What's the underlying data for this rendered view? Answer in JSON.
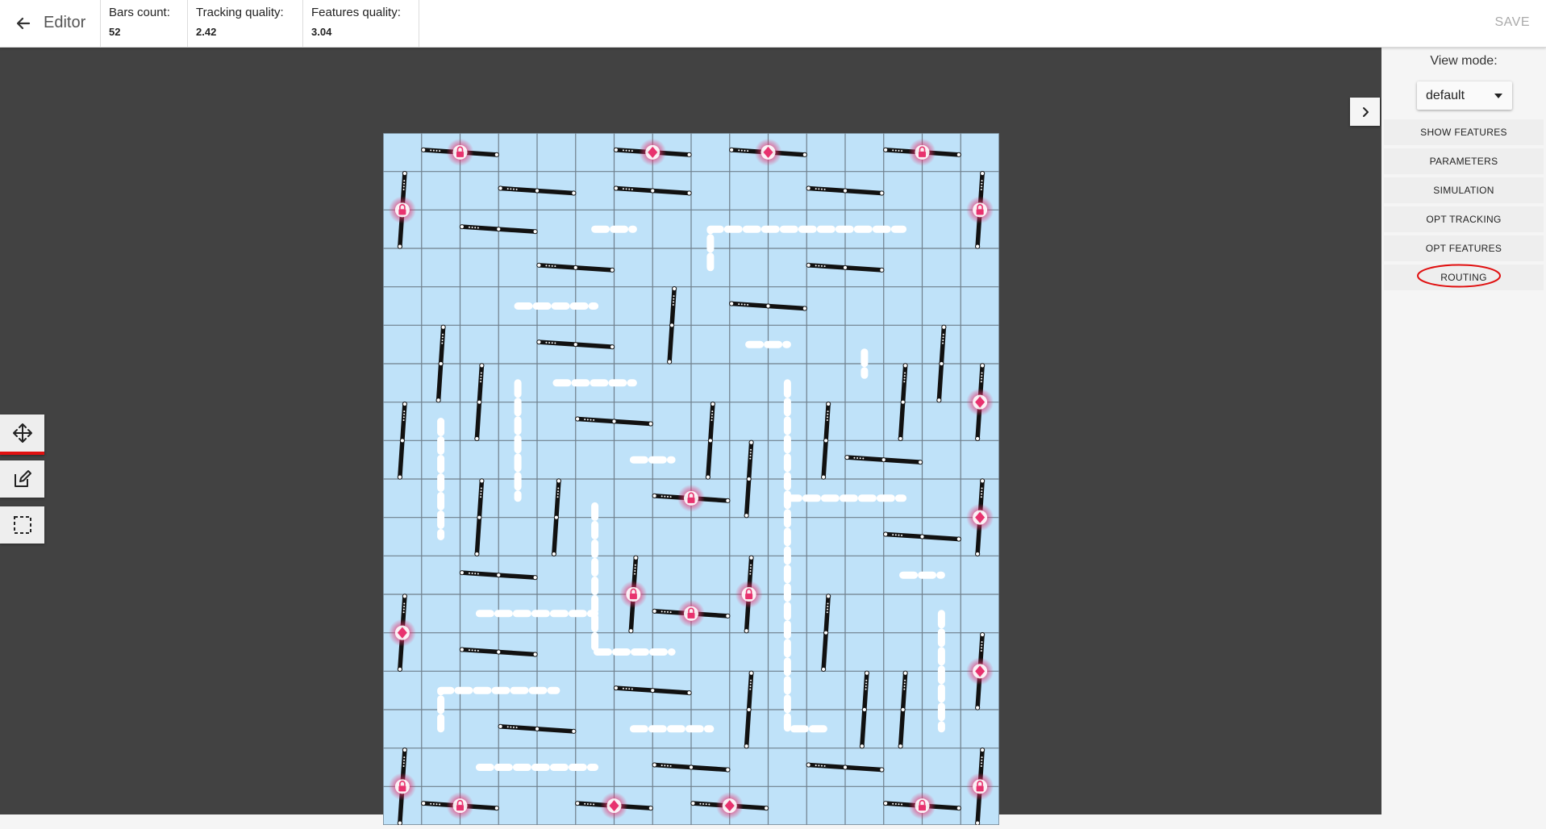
{
  "header": {
    "title": "Editor",
    "stats": [
      {
        "label": "Bars count:",
        "value": "52"
      },
      {
        "label": "Tracking quality:",
        "value": "2.42"
      },
      {
        "label": "Features quality:",
        "value": "3.04"
      }
    ],
    "save_label": "SAVE"
  },
  "panel": {
    "view_mode_label": "View mode:",
    "view_mode_value": "default",
    "buttons": [
      {
        "label": "SHOW FEATURES"
      },
      {
        "label": "PARAMETERS"
      },
      {
        "label": "SIMULATION"
      },
      {
        "label": "OPT TRACKING"
      },
      {
        "label": "OPT FEATURES"
      },
      {
        "label": "ROUTING"
      }
    ]
  },
  "tools": [
    {
      "icon": "move-icon",
      "active": true
    },
    {
      "icon": "edit-icon",
      "active": false
    },
    {
      "icon": "select-rect-icon",
      "active": false
    }
  ],
  "colors": {
    "board_fill": "#bfe2f9",
    "grid_line": "#6f7f8c",
    "bar": "#111111",
    "route": "#ffffff",
    "lock": "#e8326e",
    "highlight": "#e01010",
    "workspace": "#424242"
  },
  "board": {
    "cols": 16,
    "rows": 18,
    "bars": [
      {
        "type": "h",
        "col": 1,
        "row": 0,
        "pinned": true,
        "lock": "lock"
      },
      {
        "type": "h",
        "col": 6,
        "row": 0,
        "pinned": true,
        "lock": "diamond"
      },
      {
        "type": "h",
        "col": 9,
        "row": 0,
        "pinned": true,
        "lock": "diamond"
      },
      {
        "type": "h",
        "col": 13,
        "row": 0,
        "pinned": true,
        "lock": "lock"
      },
      {
        "type": "h",
        "col": 3,
        "row": 1
      },
      {
        "type": "h",
        "col": 6,
        "row": 1
      },
      {
        "type": "h",
        "col": 11,
        "row": 1
      },
      {
        "type": "h",
        "col": 2,
        "row": 2
      },
      {
        "type": "h",
        "col": 4,
        "row": 3
      },
      {
        "type": "h",
        "col": 11,
        "row": 3
      },
      {
        "type": "h",
        "col": 9,
        "row": 4
      },
      {
        "type": "h",
        "col": 4,
        "row": 5
      },
      {
        "type": "h",
        "col": 5,
        "row": 7
      },
      {
        "type": "h",
        "col": 12,
        "row": 8
      },
      {
        "type": "h",
        "col": 7,
        "row": 9,
        "pinned": true,
        "lock": "lock"
      },
      {
        "type": "h",
        "col": 13,
        "row": 10
      },
      {
        "type": "h",
        "col": 2,
        "row": 11
      },
      {
        "type": "h",
        "col": 7,
        "row": 12,
        "pinned": true,
        "lock": "lock"
      },
      {
        "type": "h",
        "col": 2,
        "row": 13
      },
      {
        "type": "h",
        "col": 6,
        "row": 14
      },
      {
        "type": "h",
        "col": 3,
        "row": 15
      },
      {
        "type": "h",
        "col": 7,
        "row": 16
      },
      {
        "type": "h",
        "col": 11,
        "row": 16
      },
      {
        "type": "h",
        "col": 1,
        "row": 17,
        "pinned": true,
        "lock": "lock"
      },
      {
        "type": "h",
        "col": 5,
        "row": 17,
        "pinned": true,
        "lock": "diamond"
      },
      {
        "type": "h",
        "col": 8,
        "row": 17,
        "pinned": true,
        "lock": "diamond"
      },
      {
        "type": "h",
        "col": 13,
        "row": 17,
        "pinned": true,
        "lock": "lock"
      },
      {
        "type": "v",
        "col": 0,
        "row": 1,
        "pinned": true,
        "lock": "lock"
      },
      {
        "type": "v",
        "col": 15,
        "row": 1,
        "pinned": true,
        "lock": "lock"
      },
      {
        "type": "v",
        "col": 7,
        "row": 4
      },
      {
        "type": "v",
        "col": 1,
        "row": 5
      },
      {
        "type": "v",
        "col": 14,
        "row": 5
      },
      {
        "type": "v",
        "col": 2,
        "row": 6
      },
      {
        "type": "v",
        "col": 13,
        "row": 6
      },
      {
        "type": "v",
        "col": 15,
        "row": 6,
        "pinned": true,
        "lock": "diamond"
      },
      {
        "type": "v",
        "col": 0,
        "row": 7
      },
      {
        "type": "v",
        "col": 8,
        "row": 7
      },
      {
        "type": "v",
        "col": 11,
        "row": 7
      },
      {
        "type": "v",
        "col": 9,
        "row": 8
      },
      {
        "type": "v",
        "col": 2,
        "row": 9
      },
      {
        "type": "v",
        "col": 4,
        "row": 9
      },
      {
        "type": "v",
        "col": 15,
        "row": 9,
        "pinned": true,
        "lock": "diamond"
      },
      {
        "type": "v",
        "col": 6,
        "row": 11,
        "pinned": true,
        "lock": "lock"
      },
      {
        "type": "v",
        "col": 9,
        "row": 11,
        "pinned": true,
        "lock": "lock"
      },
      {
        "type": "v",
        "col": 0,
        "row": 12,
        "pinned": true,
        "lock": "diamond"
      },
      {
        "type": "v",
        "col": 11,
        "row": 12
      },
      {
        "type": "v",
        "col": 15,
        "row": 13,
        "pinned": true,
        "lock": "diamond"
      },
      {
        "type": "v",
        "col": 9,
        "row": 14
      },
      {
        "type": "v",
        "col": 12,
        "row": 14
      },
      {
        "type": "v",
        "col": 13,
        "row": 14
      },
      {
        "type": "v",
        "col": 0,
        "row": 16,
        "pinned": true,
        "lock": "lock"
      },
      {
        "type": "v",
        "col": 15,
        "row": 16,
        "pinned": true,
        "lock": "lock"
      }
    ],
    "routes": [
      [
        [
          5.5,
          2.5
        ],
        [
          6.5,
          2.5
        ]
      ],
      [
        [
          8.5,
          3.5
        ],
        [
          8.5,
          2.5
        ],
        [
          13.5,
          2.5
        ]
      ],
      [
        [
          3.5,
          4.5
        ],
        [
          5.5,
          4.5
        ]
      ],
      [
        [
          9.5,
          5.5
        ],
        [
          10.5,
          5.5
        ]
      ],
      [
        [
          12.5,
          5.7
        ],
        [
          12.5,
          6.3
        ]
      ],
      [
        [
          4.5,
          6.5
        ],
        [
          6.5,
          6.5
        ]
      ],
      [
        [
          3.5,
          6.5
        ],
        [
          3.5,
          9.5
        ]
      ],
      [
        [
          1.5,
          7.5
        ],
        [
          1.5,
          10.5
        ]
      ],
      [
        [
          6.5,
          8.5
        ],
        [
          7.5,
          8.5
        ]
      ],
      [
        [
          10.5,
          6.5
        ],
        [
          10.5,
          15.5
        ],
        [
          11.5,
          15.5
        ]
      ],
      [
        [
          10.5,
          9.5
        ],
        [
          13.5,
          9.5
        ]
      ],
      [
        [
          5.5,
          9.7
        ],
        [
          5.5,
          13.5
        ],
        [
          7.5,
          13.5
        ]
      ],
      [
        [
          2.5,
          12.5
        ],
        [
          5.5,
          12.5
        ]
      ],
      [
        [
          13.5,
          11.5
        ],
        [
          14.5,
          11.5
        ]
      ],
      [
        [
          14.5,
          12.5
        ],
        [
          14.5,
          15.5
        ]
      ],
      [
        [
          1.5,
          15.5
        ],
        [
          1.5,
          14.5
        ],
        [
          4.5,
          14.5
        ]
      ],
      [
        [
          6.5,
          15.5
        ],
        [
          8.5,
          15.5
        ]
      ],
      [
        [
          2.5,
          16.5
        ],
        [
          5.5,
          16.5
        ]
      ]
    ]
  }
}
